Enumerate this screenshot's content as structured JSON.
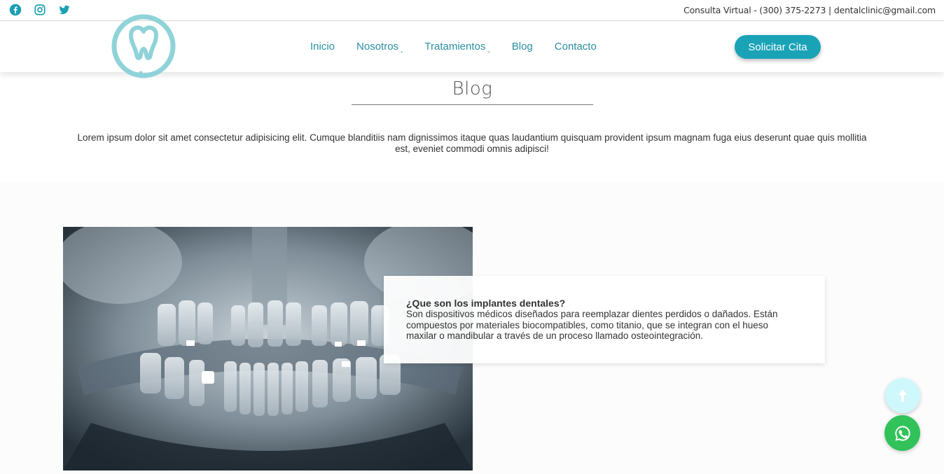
{
  "topbar": {
    "social": [
      {
        "name": "facebook-icon",
        "color": "#1a9fb3"
      },
      {
        "name": "instagram-icon",
        "color": "#1a9fb3"
      },
      {
        "name": "twitter-icon",
        "color": "#1a9fb3"
      }
    ],
    "contact": "Consulta Virtual - (300) 375-2273 | dentalclinic@gmail.com"
  },
  "nav": {
    "logo_icon": "tooth-logo-icon",
    "items": [
      {
        "label": "Inicio",
        "dropdown": false
      },
      {
        "label": "Nosotros",
        "dropdown": true
      },
      {
        "label": "Tratamientos",
        "dropdown": true
      },
      {
        "label": "Blog",
        "dropdown": false
      },
      {
        "label": "Contacto",
        "dropdown": false
      }
    ],
    "dropdown_caret": "ˬ",
    "cta_label": "Solicitar Cita",
    "accent": "#1aa3b7"
  },
  "hero": {
    "title": "Blog",
    "intro": "Lorem ipsum dolor sit amet consectetur adipisicing elit. Cumque blanditiis nam dignissimos itaque quas laudantium quisquam provident ipsum magnam fuga eius deserunt quae quis mollitia est, eveniet commodi omnis adipisci!"
  },
  "post": {
    "image_icon": "dental-xray-image",
    "title": "¿Que son los implantes dentales?",
    "body": "Son dispositivos médicos diseñados para reemplazar dientes perdidos o dañados. Están compuestos por materiales biocompatibles, como titanio, que se integran con el hueso maxilar o mandibular a través de un proceso llamado osteointegración."
  },
  "floating": {
    "up_icon": "arrow-up-icon",
    "whatsapp_icon": "whatsapp-icon",
    "whatsapp_color": "#32c25a"
  }
}
